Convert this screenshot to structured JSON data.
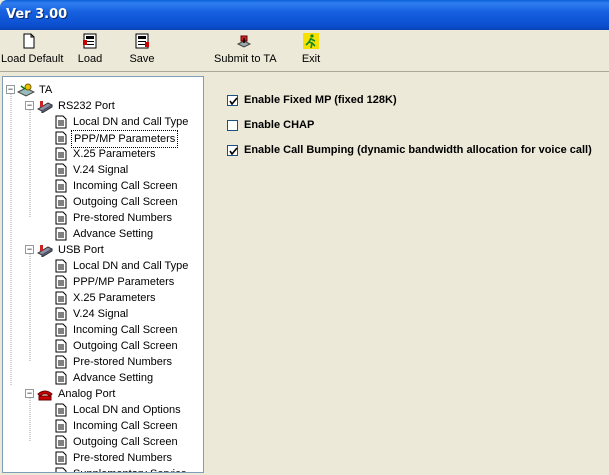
{
  "window": {
    "title": "Ver 3.00"
  },
  "toolbar": {
    "buttons": [
      {
        "label": "Load Default",
        "icon": "new-document-icon"
      },
      {
        "label": "Load",
        "icon": "load-icon"
      },
      {
        "label": "Save",
        "icon": "save-icon"
      },
      {
        "label": "Submit to TA",
        "icon": "submit-icon"
      },
      {
        "label": "Exit",
        "icon": "exit-running-man-icon"
      }
    ]
  },
  "tree": {
    "root": "TA",
    "groups": [
      {
        "label": "RS232 Port",
        "items": [
          "Local DN and Call Type",
          "PPP/MP Parameters",
          "X.25 Parameters",
          "V.24 Signal",
          "Incoming Call Screen",
          "Outgoing Call Screen",
          "Pre-stored Numbers",
          "Advance Setting"
        ]
      },
      {
        "label": "USB Port",
        "items": [
          "Local DN and Call Type",
          "PPP/MP Parameters",
          "X.25 Parameters",
          "V.24 Signal",
          "Incoming Call Screen",
          "Outgoing Call Screen",
          "Pre-stored Numbers",
          "Advance Setting"
        ]
      },
      {
        "label": "Analog Port",
        "items": [
          "Local DN and Options",
          "Incoming Call Screen",
          "Outgoing Call Screen",
          "Pre-stored Numbers",
          "Supplementary Service"
        ]
      }
    ],
    "selected": "RS232 Port / PPP/MP Parameters"
  },
  "options": {
    "items": [
      {
        "label": "Enable Fixed MP (fixed 128K)",
        "checked": true
      },
      {
        "label": "Enable CHAP",
        "checked": false
      },
      {
        "label": "Enable Call Bumping (dynamic bandwidth allocation for voice call)",
        "checked": true
      }
    ]
  }
}
